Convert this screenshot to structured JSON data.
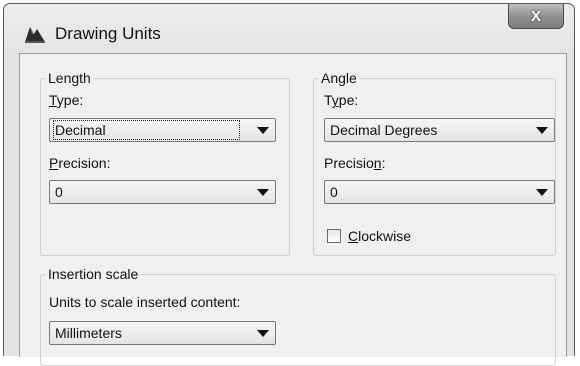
{
  "window": {
    "title": "Drawing Units",
    "close_symbol": "X",
    "icon": "drawing-units-app-icon"
  },
  "length": {
    "group_label": "Length",
    "type_label": "Type:",
    "type_value": "Decimal",
    "precision_label": "Precision:",
    "precision_value": "0"
  },
  "angle": {
    "group_label": "Angle",
    "type_label": "Type:",
    "type_value": "Decimal Degrees",
    "precision_label": "Precision:",
    "precision_value": "0",
    "clockwise_label": "Clockwise",
    "clockwise_checked": false
  },
  "insertion": {
    "group_label": "Insertion scale",
    "units_label": "Units to scale inserted content:",
    "units_value": "Millimeters"
  }
}
